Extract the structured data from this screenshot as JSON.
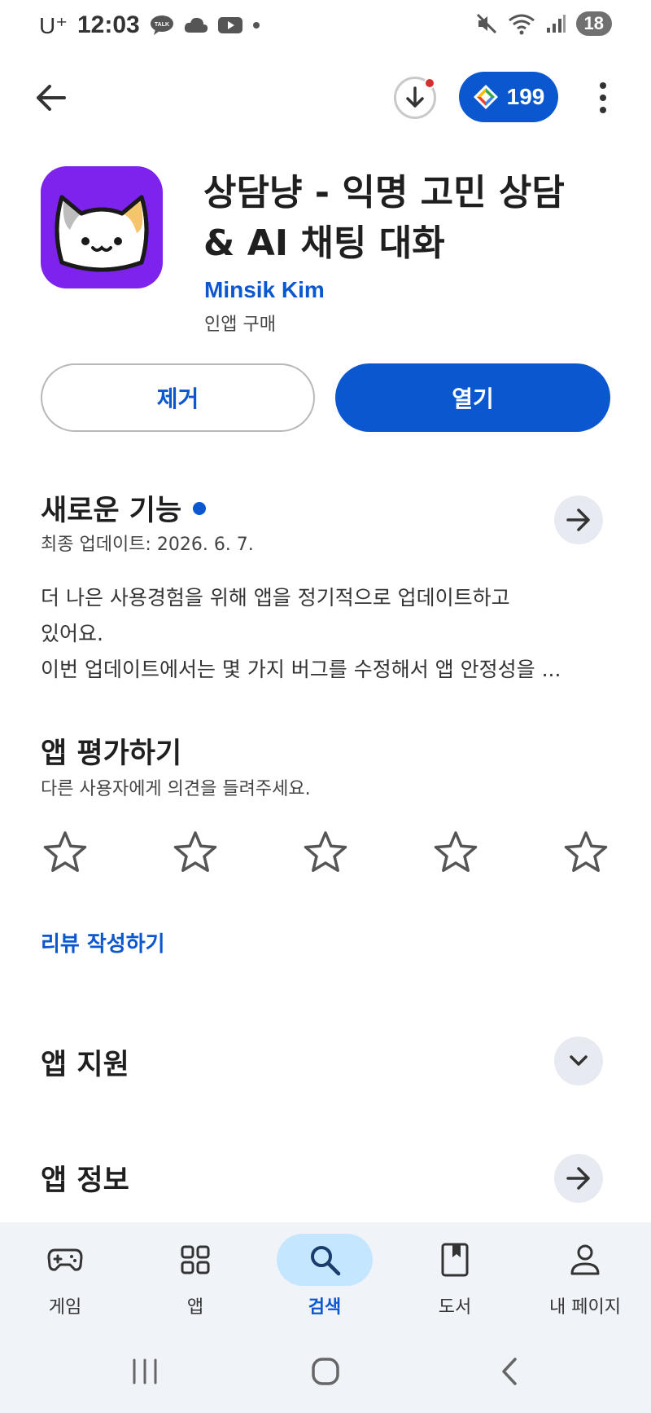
{
  "status_bar": {
    "carrier": "U⁺",
    "time": "12:03",
    "talk_badge": "TALK",
    "battery": "18"
  },
  "appbar": {
    "points": "199"
  },
  "app": {
    "title_line1": "상담냥 - 익명 고민 상담",
    "title_line2": "& AI 채팅 대화",
    "developer": "Minsik Kim",
    "purchase_note": "인앱 구매",
    "icon_color": "#7e22ee"
  },
  "actions": {
    "remove_label": "제거",
    "open_label": "열기"
  },
  "whats_new": {
    "title": "새로운 기능",
    "updated": "최종 업데이트: 2026. 6. 7.",
    "line1": "더 나은 사용경험을 위해 앱을 정기적으로 업데이트하고",
    "line2": "있어요.",
    "line3": "이번 업데이트에서는 몇 가지 버그를 수정해서 앱 안정성을 ..."
  },
  "rate": {
    "title": "앱 평가하기",
    "subtitle": "다른 사용자에게 의견을 들려주세요.",
    "stars": 0,
    "review_link": "리뷰 작성하기"
  },
  "support": {
    "title": "앱 지원"
  },
  "info": {
    "title": "앱 정보"
  },
  "bottom_nav": {
    "items": [
      {
        "label": "게임",
        "icon": "gamepad-icon"
      },
      {
        "label": "앱",
        "icon": "apps-grid-icon"
      },
      {
        "label": "검색",
        "icon": "search-icon",
        "active": true
      },
      {
        "label": "도서",
        "icon": "book-icon"
      },
      {
        "label": "내 페이지",
        "icon": "person-icon"
      }
    ]
  },
  "colors": {
    "accent": "#0b57d0",
    "nav_active_pill": "#c4e7ff",
    "round_button": "#e8eaf2"
  }
}
